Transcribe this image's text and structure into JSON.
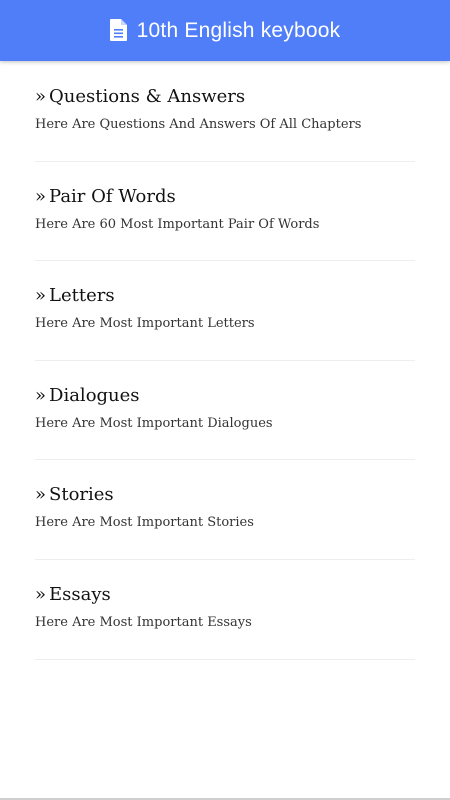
{
  "app_bar": {
    "title": "10th English keybook",
    "icon": "document-icon",
    "color": "#4f7ef8"
  },
  "items": [
    {
      "marker": "»",
      "title": "Questions & Answers",
      "description": "Here Are Questions And Answers Of All Chapters"
    },
    {
      "marker": "»",
      "title": "Pair Of Words",
      "description": "Here Are 60 Most Important Pair Of Words"
    },
    {
      "marker": "»",
      "title": "Letters",
      "description": "Here Are Most Important Letters"
    },
    {
      "marker": "»",
      "title": "Dialogues",
      "description": "Here Are Most Important Dialogues"
    },
    {
      "marker": "»",
      "title": "Stories",
      "description": "Here Are Most Important Stories"
    },
    {
      "marker": "»",
      "title": "Essays",
      "description": "Here Are Most Important Essays"
    }
  ]
}
